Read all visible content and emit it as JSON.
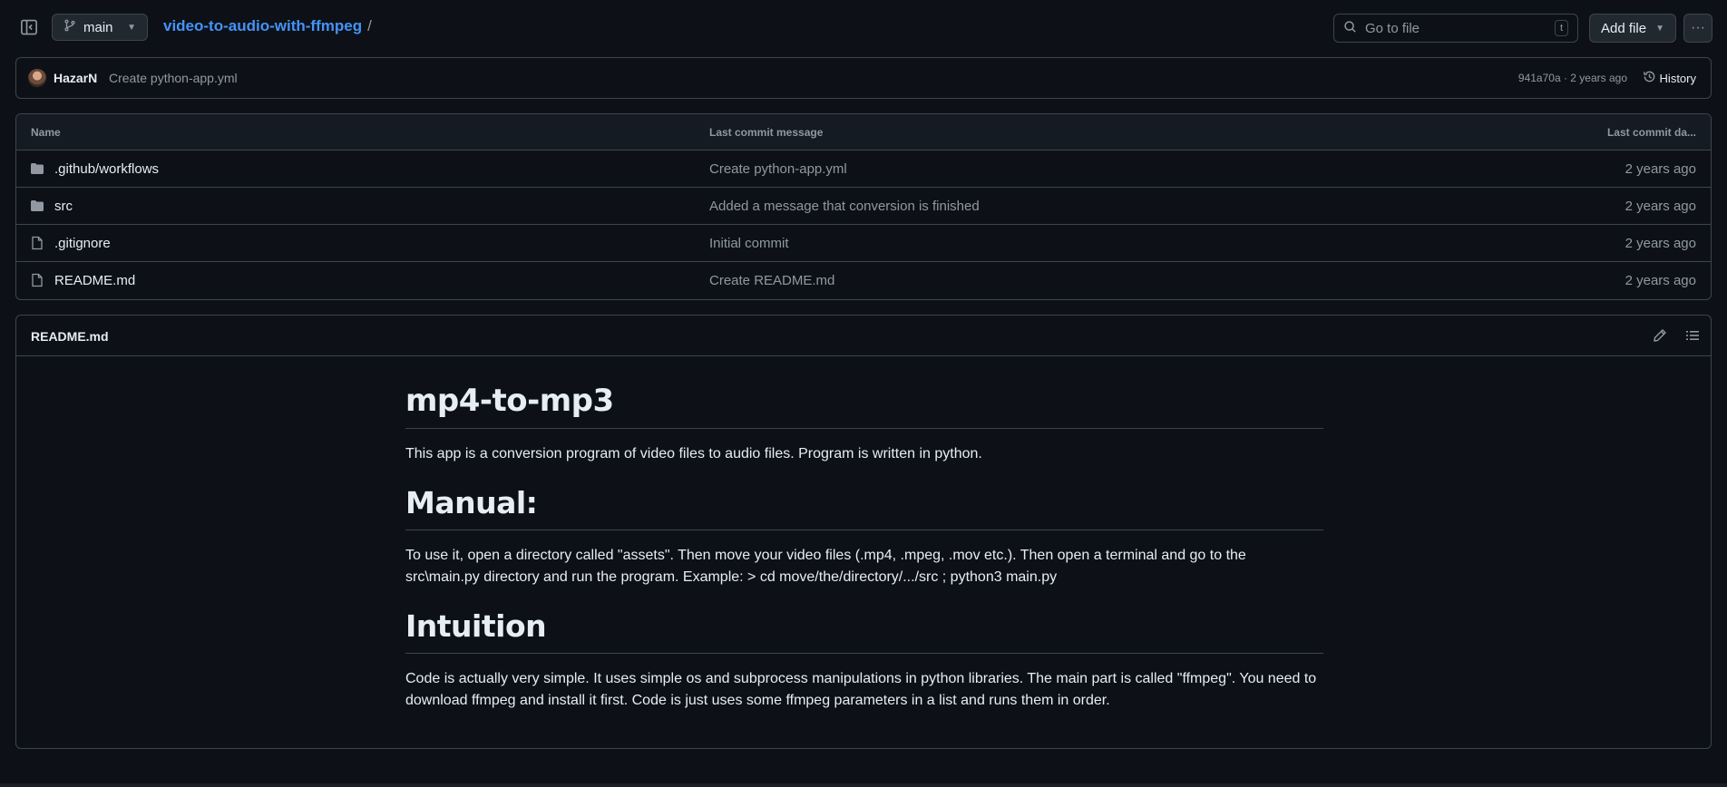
{
  "header": {
    "branch": "main",
    "repo": "video-to-audio-with-ffmpeg",
    "separator": "/",
    "search_placeholder": "Go to file",
    "search_shortcut": "t",
    "add_file": "Add file"
  },
  "commit": {
    "author": "HazarN",
    "message": "Create python-app.yml",
    "meta": "941a70a · 2 years ago",
    "history": "History"
  },
  "table": {
    "headers": {
      "name": "Name",
      "message": "Last commit message",
      "date": "Last commit da..."
    },
    "rows": [
      {
        "type": "folder",
        "name": ".github/workflows",
        "message": "Create python-app.yml",
        "date": "2 years ago"
      },
      {
        "type": "folder",
        "name": "src",
        "message": "Added a message that conversion is finished",
        "date": "2 years ago"
      },
      {
        "type": "file",
        "name": ".gitignore",
        "message": "Initial commit",
        "date": "2 years ago"
      },
      {
        "type": "file",
        "name": "README.md",
        "message": "Create README.md",
        "date": "2 years ago"
      }
    ]
  },
  "readme": {
    "title": "README.md",
    "h1": "mp4-to-mp3",
    "intro": "This app is a conversion program of video files to audio files. Program is written in python.",
    "manual_heading": "Manual:",
    "manual_text": "To use it, open a directory called \"assets\". Then move your video files (.mp4, .mpeg, .mov etc.). Then open a terminal and go to the src\\main.py directory and run the program. Example: > cd move/the/directory/.../src ; python3 main.py",
    "intuition_heading": "Intuition",
    "intuition_text": "Code is actually very simple. It uses simple os and subprocess manipulations in python libraries. The main part is called \"ffmpeg\". You need to download ffmpeg and install it first. Code is just uses some ffmpeg parameters in a list and runs them in order."
  },
  "icons": {
    "sidebar": "sidebar-collapse-icon",
    "branch": "git-branch-icon",
    "search": "search-icon",
    "more": "kebab-horizontal-icon",
    "history": "history-icon",
    "folder": "folder-icon",
    "file": "file-icon",
    "edit": "pencil-icon",
    "outline": "list-unordered-icon"
  },
  "colors": {
    "background": "#0d1117",
    "link": "#4493f8",
    "border": "#3d444d",
    "muted": "#9198a1"
  }
}
